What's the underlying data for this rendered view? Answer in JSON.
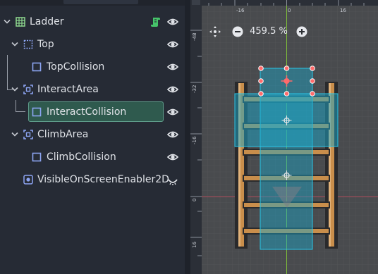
{
  "scene_tree": {
    "nodes": [
      {
        "label": "Ladder",
        "icon": "grid-icon",
        "depth": 0,
        "expanded": true
      },
      {
        "label": "Top",
        "icon": "dotted-square-icon",
        "depth": 1,
        "expanded": true
      },
      {
        "label": "TopCollision",
        "icon": "square-icon",
        "depth": 2
      },
      {
        "label": "InteractArea",
        "icon": "area-icon",
        "depth": 1,
        "expanded": true
      },
      {
        "label": "InteractCollision",
        "icon": "square-icon",
        "depth": 2,
        "selected": true
      },
      {
        "label": "ClimbArea",
        "icon": "area-icon",
        "depth": 1,
        "expanded": true
      },
      {
        "label": "ClimbCollision",
        "icon": "square-icon",
        "depth": 2
      },
      {
        "label": "VisibleOnScreenEnabler2D",
        "icon": "target-icon",
        "depth": 1
      }
    ],
    "script_icon": "script-icon",
    "visibility_icon": "eye-icon"
  },
  "viewport": {
    "zoom_label": "459.5 %",
    "ruler_top_labels": [
      "-16",
      "0",
      "16"
    ],
    "ruler_left_labels": [
      "-48",
      "-32",
      "-16",
      "0",
      "16"
    ],
    "tools": [
      "center-view-icon",
      "zoom-out-icon",
      "zoom-in-icon"
    ]
  },
  "colors": {
    "panel_bg": "#262b35",
    "viewport_bg": "#494b4e",
    "selection": "#2f5a4e",
    "accent_green": "#46c46a",
    "collision_fill": "#1ba7c9",
    "ladder_wood": "#c98e4b"
  }
}
